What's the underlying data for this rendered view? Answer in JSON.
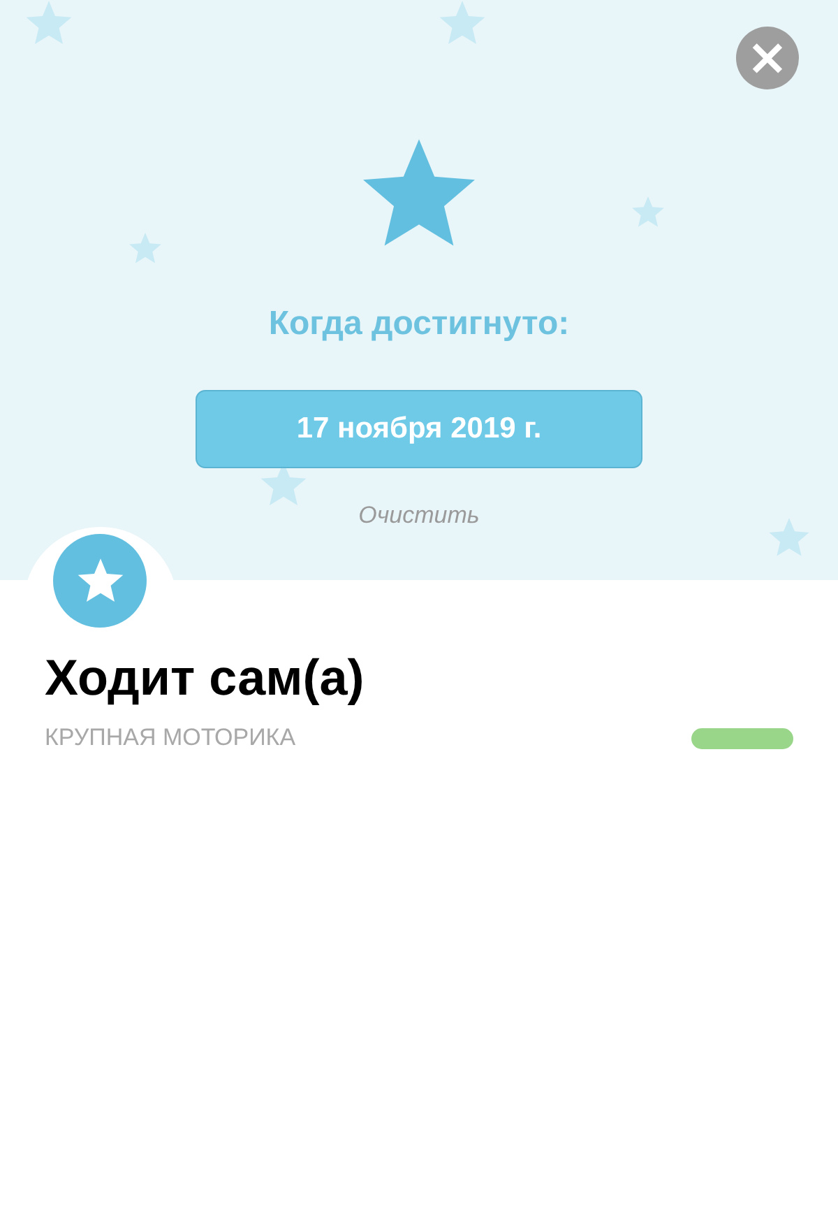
{
  "header": {
    "close_label": "×",
    "title": "Когда достигнуто:",
    "date": "17 ноября 2019 г.",
    "clear_link": "Очистить"
  },
  "milestone": {
    "title": "Ходит сам(а)",
    "category": "КРУПНАЯ МОТОРИКА"
  }
}
